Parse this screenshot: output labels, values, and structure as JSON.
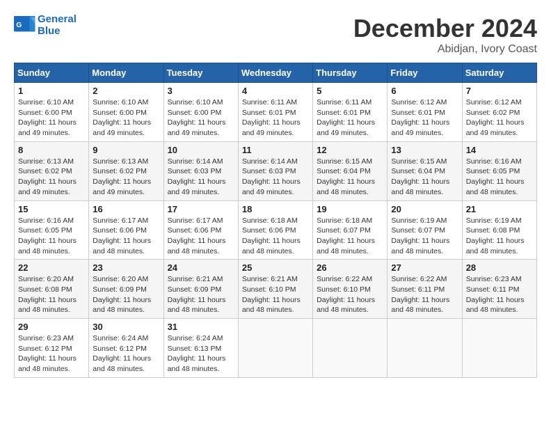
{
  "header": {
    "logo_text_general": "General",
    "logo_text_blue": "Blue",
    "month_title": "December 2024",
    "location": "Abidjan, Ivory Coast"
  },
  "weekdays": [
    "Sunday",
    "Monday",
    "Tuesday",
    "Wednesday",
    "Thursday",
    "Friday",
    "Saturday"
  ],
  "weeks": [
    [
      {
        "day": "1",
        "sunrise": "6:10 AM",
        "sunset": "6:00 PM",
        "daylight": "11 hours and 49 minutes."
      },
      {
        "day": "2",
        "sunrise": "6:10 AM",
        "sunset": "6:00 PM",
        "daylight": "11 hours and 49 minutes."
      },
      {
        "day": "3",
        "sunrise": "6:10 AM",
        "sunset": "6:00 PM",
        "daylight": "11 hours and 49 minutes."
      },
      {
        "day": "4",
        "sunrise": "6:11 AM",
        "sunset": "6:01 PM",
        "daylight": "11 hours and 49 minutes."
      },
      {
        "day": "5",
        "sunrise": "6:11 AM",
        "sunset": "6:01 PM",
        "daylight": "11 hours and 49 minutes."
      },
      {
        "day": "6",
        "sunrise": "6:12 AM",
        "sunset": "6:01 PM",
        "daylight": "11 hours and 49 minutes."
      },
      {
        "day": "7",
        "sunrise": "6:12 AM",
        "sunset": "6:02 PM",
        "daylight": "11 hours and 49 minutes."
      }
    ],
    [
      {
        "day": "8",
        "sunrise": "6:13 AM",
        "sunset": "6:02 PM",
        "daylight": "11 hours and 49 minutes."
      },
      {
        "day": "9",
        "sunrise": "6:13 AM",
        "sunset": "6:02 PM",
        "daylight": "11 hours and 49 minutes."
      },
      {
        "day": "10",
        "sunrise": "6:14 AM",
        "sunset": "6:03 PM",
        "daylight": "11 hours and 49 minutes."
      },
      {
        "day": "11",
        "sunrise": "6:14 AM",
        "sunset": "6:03 PM",
        "daylight": "11 hours and 49 minutes."
      },
      {
        "day": "12",
        "sunrise": "6:15 AM",
        "sunset": "6:04 PM",
        "daylight": "11 hours and 48 minutes."
      },
      {
        "day": "13",
        "sunrise": "6:15 AM",
        "sunset": "6:04 PM",
        "daylight": "11 hours and 48 minutes."
      },
      {
        "day": "14",
        "sunrise": "6:16 AM",
        "sunset": "6:05 PM",
        "daylight": "11 hours and 48 minutes."
      }
    ],
    [
      {
        "day": "15",
        "sunrise": "6:16 AM",
        "sunset": "6:05 PM",
        "daylight": "11 hours and 48 minutes."
      },
      {
        "day": "16",
        "sunrise": "6:17 AM",
        "sunset": "6:06 PM",
        "daylight": "11 hours and 48 minutes."
      },
      {
        "day": "17",
        "sunrise": "6:17 AM",
        "sunset": "6:06 PM",
        "daylight": "11 hours and 48 minutes."
      },
      {
        "day": "18",
        "sunrise": "6:18 AM",
        "sunset": "6:06 PM",
        "daylight": "11 hours and 48 minutes."
      },
      {
        "day": "19",
        "sunrise": "6:18 AM",
        "sunset": "6:07 PM",
        "daylight": "11 hours and 48 minutes."
      },
      {
        "day": "20",
        "sunrise": "6:19 AM",
        "sunset": "6:07 PM",
        "daylight": "11 hours and 48 minutes."
      },
      {
        "day": "21",
        "sunrise": "6:19 AM",
        "sunset": "6:08 PM",
        "daylight": "11 hours and 48 minutes."
      }
    ],
    [
      {
        "day": "22",
        "sunrise": "6:20 AM",
        "sunset": "6:08 PM",
        "daylight": "11 hours and 48 minutes."
      },
      {
        "day": "23",
        "sunrise": "6:20 AM",
        "sunset": "6:09 PM",
        "daylight": "11 hours and 48 minutes."
      },
      {
        "day": "24",
        "sunrise": "6:21 AM",
        "sunset": "6:09 PM",
        "daylight": "11 hours and 48 minutes."
      },
      {
        "day": "25",
        "sunrise": "6:21 AM",
        "sunset": "6:10 PM",
        "daylight": "11 hours and 48 minutes."
      },
      {
        "day": "26",
        "sunrise": "6:22 AM",
        "sunset": "6:10 PM",
        "daylight": "11 hours and 48 minutes."
      },
      {
        "day": "27",
        "sunrise": "6:22 AM",
        "sunset": "6:11 PM",
        "daylight": "11 hours and 48 minutes."
      },
      {
        "day": "28",
        "sunrise": "6:23 AM",
        "sunset": "6:11 PM",
        "daylight": "11 hours and 48 minutes."
      }
    ],
    [
      {
        "day": "29",
        "sunrise": "6:23 AM",
        "sunset": "6:12 PM",
        "daylight": "11 hours and 48 minutes."
      },
      {
        "day": "30",
        "sunrise": "6:24 AM",
        "sunset": "6:12 PM",
        "daylight": "11 hours and 48 minutes."
      },
      {
        "day": "31",
        "sunrise": "6:24 AM",
        "sunset": "6:13 PM",
        "daylight": "11 hours and 48 minutes."
      },
      null,
      null,
      null,
      null
    ]
  ]
}
